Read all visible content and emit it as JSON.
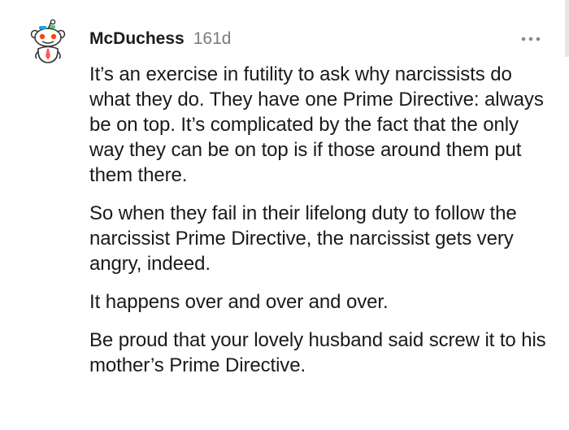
{
  "comment": {
    "username": "McDuchess",
    "age": "161d",
    "avatar_icon": "snoo-avatar-icon",
    "menu_icon": "more-options-icon",
    "paragraphs": [
      "It’s an exercise in futility to ask why narcissists do what they do. They have one Prime Directive: always be on top. It’s complicated by the fact that the only way they can be on top is if those around them put them there.",
      "So when they fail in their lifelong duty to follow the narcissist Prime Directive, the narcissist gets very angry, indeed.",
      "It happens over and over and over.",
      "Be proud that your lovely husband said screw it to his mother’s Prime Directive."
    ]
  },
  "colors": {
    "text": "#1a1a1b",
    "muted": "#7c7c7c",
    "accent": "#ff4500"
  }
}
